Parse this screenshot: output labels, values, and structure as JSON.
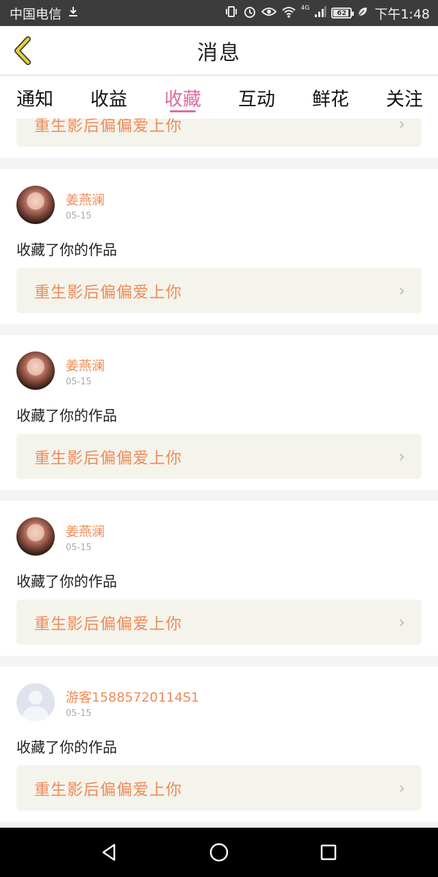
{
  "status_bar": {
    "carrier": "中国电信",
    "time": "下午1:48",
    "battery": "62",
    "network": "4G",
    "icons": [
      "download-icon",
      "vibrate-icon",
      "alarm-icon",
      "eye-icon",
      "wifi-icon",
      "signal-icon",
      "battery-icon",
      "leaf-icon"
    ]
  },
  "header": {
    "title": "消息",
    "accent_color": "#e06aa0",
    "back_icon_color": "#e0d238"
  },
  "tabs": [
    {
      "label": "通知",
      "active": false
    },
    {
      "label": "收益",
      "active": false
    },
    {
      "label": "收藏",
      "active": true
    },
    {
      "label": "互动",
      "active": false
    },
    {
      "label": "鲜花",
      "active": false
    },
    {
      "label": "关注",
      "active": false
    }
  ],
  "notifications": [
    {
      "work_title": "重生影后偏偏爱上你"
    },
    {
      "user_name": "姜燕澜",
      "date": "05-15",
      "activity": "收藏了你的作品",
      "work_title": "重生影后偏偏爱上你",
      "avatar": "photo"
    },
    {
      "user_name": "姜燕澜",
      "date": "05-15",
      "activity": "收藏了你的作品",
      "work_title": "重生影后偏偏爱上你",
      "avatar": "photo"
    },
    {
      "user_name": "姜燕澜",
      "date": "05-15",
      "activity": "收藏了你的作品",
      "work_title": "重生影后偏偏爱上你",
      "avatar": "photo"
    },
    {
      "user_name": "游客15885720114S1",
      "date": "05-15",
      "activity": "收藏了你的作品",
      "work_title": "重生影后偏偏爱上你",
      "avatar": "default"
    }
  ],
  "colors": {
    "name_color": "#f08a57",
    "work_bg": "#f4f4ec"
  }
}
